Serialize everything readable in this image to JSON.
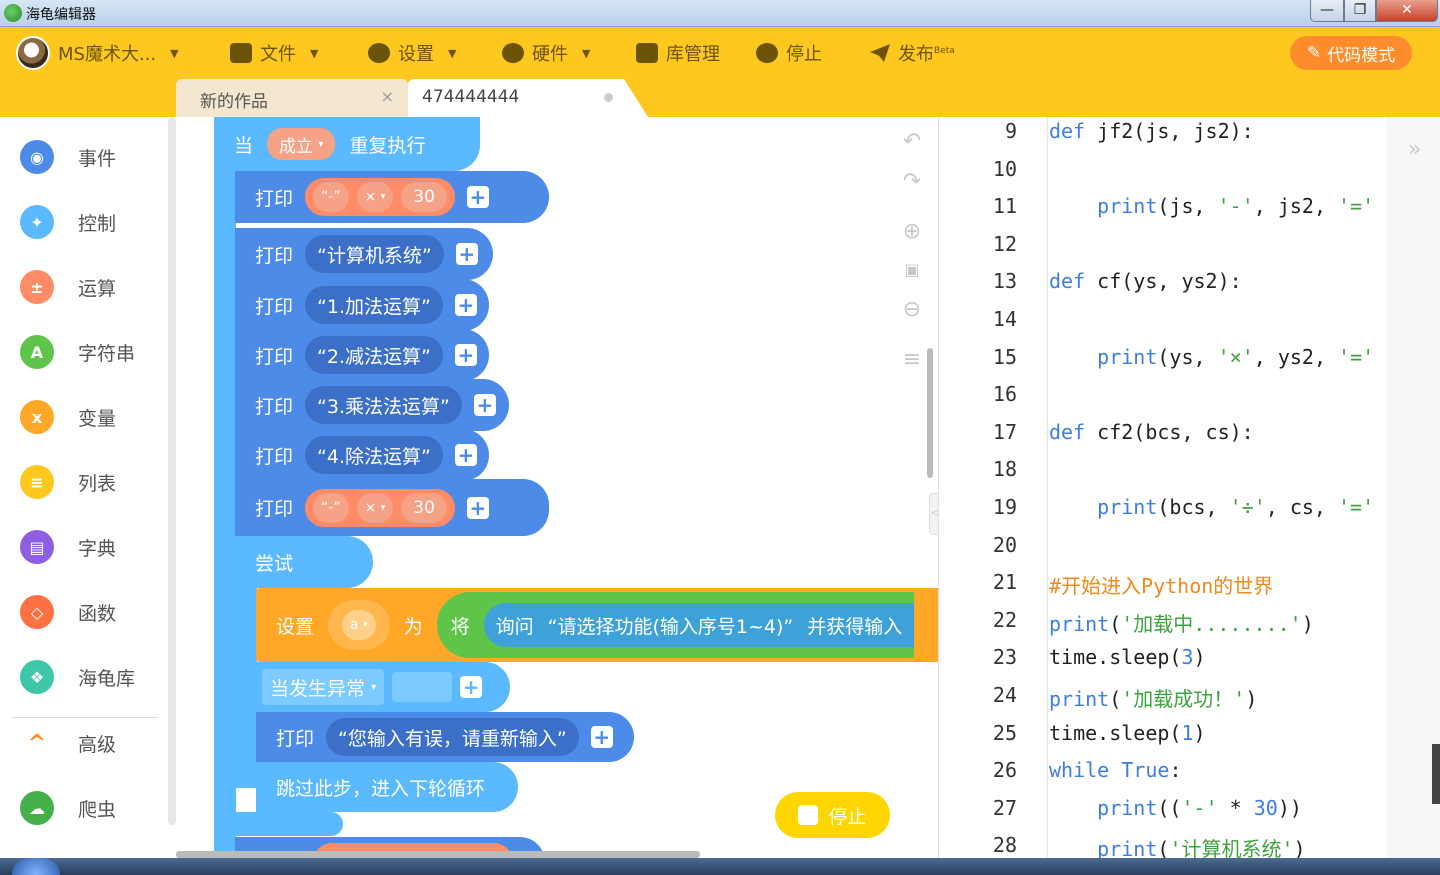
{
  "window": {
    "title": "海龟编辑器",
    "min": "—",
    "max": "❐",
    "close": "✕"
  },
  "toolbar": {
    "user": "MS魔术大...",
    "file": "文件",
    "settings": "设置",
    "hardware": "硬件",
    "library": "库管理",
    "stop": "停止",
    "publish": "发布",
    "beta": "Beta",
    "code_mode": "代码模式"
  },
  "tabs": [
    {
      "label": "新的作品",
      "close": "×"
    },
    {
      "label": "474444444"
    }
  ],
  "categories": [
    {
      "label": "事件",
      "color": "#4d8be8",
      "glyph": "◉"
    },
    {
      "label": "控制",
      "color": "#5ab9ff",
      "glyph": "✦"
    },
    {
      "label": "运算",
      "color": "#ff8c66",
      "glyph": "±"
    },
    {
      "label": "字符串",
      "color": "#5fc44a",
      "glyph": "A"
    },
    {
      "label": "变量",
      "color": "#ffa726",
      "glyph": "x"
    },
    {
      "label": "列表",
      "color": "#ffc81e",
      "glyph": "≡"
    },
    {
      "label": "字典",
      "color": "#8e5fe0",
      "glyph": "▤"
    },
    {
      "label": "函数",
      "color": "#ff7043",
      "glyph": "◇"
    },
    {
      "label": "海龟库",
      "color": "#3ec6a8",
      "glyph": "❖"
    },
    {
      "label": "高级",
      "color": "#ff8c2a",
      "glyph": "^"
    },
    {
      "label": "爬虫",
      "color": "#43b04a",
      "glyph": "☁"
    }
  ],
  "blocks": {
    "when": "当",
    "condition": "成立",
    "repeat": "重复执行",
    "print": "打印",
    "dash": "“-”",
    "times": "×",
    "thirty": "30",
    "plus": "+",
    "s1": "“计算机系统”",
    "s2": "“1.加法运算”",
    "s3": "“2.减法运算”",
    "s4": "“3.乘法法运算”",
    "s5": "“4.除法运算”",
    "try": "尝试",
    "set": "设置",
    "var": "a",
    "as": "为",
    "convert": "将",
    "ask": "询问",
    "prompt": "“请选择功能(输入序号1~4)”",
    "get_input": "并获得输入",
    "except": "当发生异常",
    "error_msg": "“您输入有误，请重新输入”",
    "skip": "跳过此步，进入下轮循环",
    "dd": "▾"
  },
  "stop_button": "停止",
  "code": {
    "lines": [
      {
        "n": "9",
        "html": "<span class=\"kw\">def</span> jf2(js, js2):"
      },
      {
        "n": "10",
        "html": ""
      },
      {
        "n": "11",
        "html": "    <span class=\"kw\">print</span>(js, <span class=\"str\">'-'</span>, js2, <span class=\"str\">'='</span>"
      },
      {
        "n": "12",
        "html": ""
      },
      {
        "n": "13",
        "html": "<span class=\"kw\">def</span> cf(ys, ys2):"
      },
      {
        "n": "14",
        "html": ""
      },
      {
        "n": "15",
        "html": "    <span class=\"kw\">print</span>(ys, <span class=\"str\">'×'</span>, ys2, <span class=\"str\">'='</span>"
      },
      {
        "n": "16",
        "html": ""
      },
      {
        "n": "17",
        "html": "<span class=\"kw\">def</span> cf2(bcs, cs):"
      },
      {
        "n": "18",
        "html": ""
      },
      {
        "n": "19",
        "html": "    <span class=\"kw\">print</span>(bcs, <span class=\"str\">'÷'</span>, cs, <span class=\"str\">'='</span>"
      },
      {
        "n": "20",
        "html": ""
      },
      {
        "n": "21",
        "html": "<span class=\"cmt\">#开始进入Python的世界</span>"
      },
      {
        "n": "22",
        "html": "<span class=\"kw\">print</span>(<span class=\"str\">'加载中........'</span>)"
      },
      {
        "n": "23",
        "html": "time.sleep(<span class=\"num\">3</span>)"
      },
      {
        "n": "24",
        "html": "<span class=\"kw\">print</span>(<span class=\"str\">'加载成功！'</span>)"
      },
      {
        "n": "25",
        "html": "time.sleep(<span class=\"num\">1</span>)"
      },
      {
        "n": "26",
        "html": "<span class=\"kw\">while</span> <span class=\"const\">True</span>:"
      },
      {
        "n": "27",
        "html": "    <span class=\"kw\">print</span>((<span class=\"str\">'-'</span> * <span class=\"num\">30</span>))"
      },
      {
        "n": "28",
        "html": "    <span class=\"kw\">print</span>(<span class=\"str\">'计算机系统'</span>)"
      }
    ]
  }
}
